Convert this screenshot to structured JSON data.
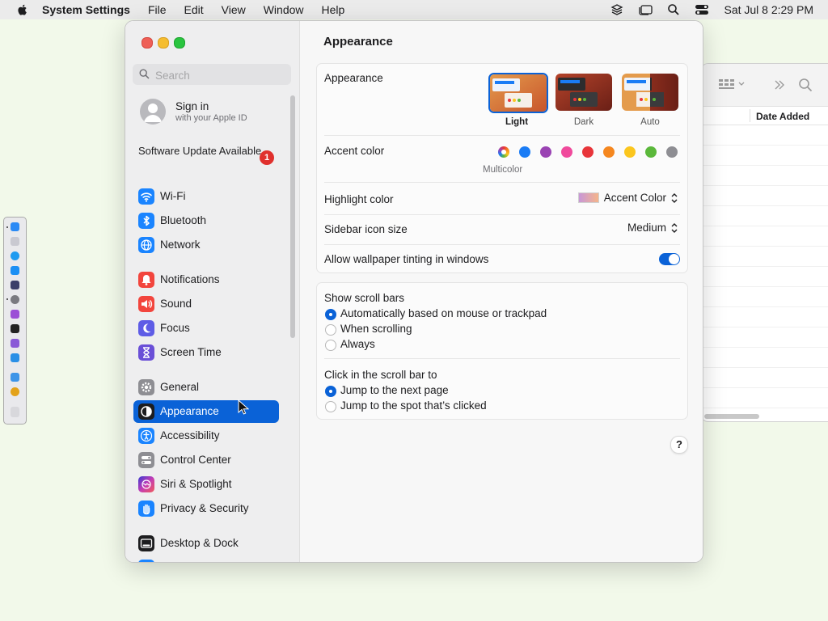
{
  "menubar": {
    "app": "System Settings",
    "items": [
      "File",
      "Edit",
      "View",
      "Window",
      "Help"
    ],
    "clock": "Sat Jul 8  2:29 PM"
  },
  "finder": {
    "column_header": "Date Added"
  },
  "sidebar": {
    "search_placeholder": "Search",
    "signin_title": "Sign in",
    "signin_subtitle": "with your Apple ID",
    "software_update": "Software Update Available",
    "update_badge": "1",
    "items": [
      {
        "label": "Wi-Fi",
        "color": "#1a84ff"
      },
      {
        "label": "Bluetooth",
        "color": "#1a84ff"
      },
      {
        "label": "Network",
        "color": "#1a84ff"
      },
      {
        "label": "Notifications",
        "color": "#f2453d"
      },
      {
        "label": "Sound",
        "color": "#f2453d"
      },
      {
        "label": "Focus",
        "color": "#5e5ce6"
      },
      {
        "label": "Screen Time",
        "color": "#6a4fd7"
      },
      {
        "label": "General",
        "color": "#8e8e93"
      },
      {
        "label": "Appearance",
        "color": "#1d1d1f"
      },
      {
        "label": "Accessibility",
        "color": "#1a84ff"
      },
      {
        "label": "Control Center",
        "color": "#8e8e93"
      },
      {
        "label": "Siri & Spotlight",
        "color": "#c33db5"
      },
      {
        "label": "Privacy & Security",
        "color": "#1a84ff"
      },
      {
        "label": "Desktop & Dock",
        "color": "#1d1d1f"
      }
    ],
    "selected": "Appearance"
  },
  "content": {
    "title": "Appearance",
    "appearance_label": "Appearance",
    "modes": [
      "Light",
      "Dark",
      "Auto"
    ],
    "selected_mode": "Light",
    "accent_label": "Accent color",
    "accent_colors": [
      "multicolor",
      "#1a7cf5",
      "#9a43b3",
      "#f04a9c",
      "#e8353a",
      "#f5871f",
      "#fbc61e",
      "#5bb83b",
      "#8e8e93"
    ],
    "accent_caption": "Multicolor",
    "highlight_label": "Highlight color",
    "highlight_value": "Accent Color",
    "sidebar_icon_label": "Sidebar icon size",
    "sidebar_icon_value": "Medium",
    "tinting_label": "Allow wallpaper tinting in windows",
    "tinting_on": true,
    "scrollbars_heading": "Show scroll bars",
    "scrollbars_options": [
      "Automatically based on mouse or trackpad",
      "When scrolling",
      "Always"
    ],
    "scrollbars_selected": "Automatically based on mouse or trackpad",
    "click_heading": "Click in the scroll bar to",
    "click_options": [
      "Jump to the next page",
      "Jump to the spot that’s clicked"
    ],
    "click_selected": "Jump to the next page",
    "help": "?"
  }
}
